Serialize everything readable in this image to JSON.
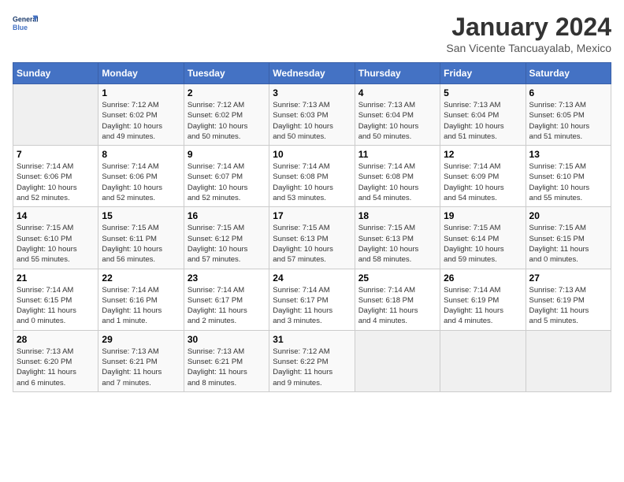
{
  "header": {
    "logo_line1": "General",
    "logo_line2": "Blue",
    "month_year": "January 2024",
    "location": "San Vicente Tancuayalab, Mexico"
  },
  "days_of_week": [
    "Sunday",
    "Monday",
    "Tuesday",
    "Wednesday",
    "Thursday",
    "Friday",
    "Saturday"
  ],
  "weeks": [
    [
      {
        "day": "",
        "info": ""
      },
      {
        "day": "1",
        "info": "Sunrise: 7:12 AM\nSunset: 6:02 PM\nDaylight: 10 hours\nand 49 minutes."
      },
      {
        "day": "2",
        "info": "Sunrise: 7:12 AM\nSunset: 6:02 PM\nDaylight: 10 hours\nand 50 minutes."
      },
      {
        "day": "3",
        "info": "Sunrise: 7:13 AM\nSunset: 6:03 PM\nDaylight: 10 hours\nand 50 minutes."
      },
      {
        "day": "4",
        "info": "Sunrise: 7:13 AM\nSunset: 6:04 PM\nDaylight: 10 hours\nand 50 minutes."
      },
      {
        "day": "5",
        "info": "Sunrise: 7:13 AM\nSunset: 6:04 PM\nDaylight: 10 hours\nand 51 minutes."
      },
      {
        "day": "6",
        "info": "Sunrise: 7:13 AM\nSunset: 6:05 PM\nDaylight: 10 hours\nand 51 minutes."
      }
    ],
    [
      {
        "day": "7",
        "info": "Sunrise: 7:14 AM\nSunset: 6:06 PM\nDaylight: 10 hours\nand 52 minutes."
      },
      {
        "day": "8",
        "info": "Sunrise: 7:14 AM\nSunset: 6:06 PM\nDaylight: 10 hours\nand 52 minutes."
      },
      {
        "day": "9",
        "info": "Sunrise: 7:14 AM\nSunset: 6:07 PM\nDaylight: 10 hours\nand 52 minutes."
      },
      {
        "day": "10",
        "info": "Sunrise: 7:14 AM\nSunset: 6:08 PM\nDaylight: 10 hours\nand 53 minutes."
      },
      {
        "day": "11",
        "info": "Sunrise: 7:14 AM\nSunset: 6:08 PM\nDaylight: 10 hours\nand 54 minutes."
      },
      {
        "day": "12",
        "info": "Sunrise: 7:14 AM\nSunset: 6:09 PM\nDaylight: 10 hours\nand 54 minutes."
      },
      {
        "day": "13",
        "info": "Sunrise: 7:15 AM\nSunset: 6:10 PM\nDaylight: 10 hours\nand 55 minutes."
      }
    ],
    [
      {
        "day": "14",
        "info": "Sunrise: 7:15 AM\nSunset: 6:10 PM\nDaylight: 10 hours\nand 55 minutes."
      },
      {
        "day": "15",
        "info": "Sunrise: 7:15 AM\nSunset: 6:11 PM\nDaylight: 10 hours\nand 56 minutes."
      },
      {
        "day": "16",
        "info": "Sunrise: 7:15 AM\nSunset: 6:12 PM\nDaylight: 10 hours\nand 57 minutes."
      },
      {
        "day": "17",
        "info": "Sunrise: 7:15 AM\nSunset: 6:13 PM\nDaylight: 10 hours\nand 57 minutes."
      },
      {
        "day": "18",
        "info": "Sunrise: 7:15 AM\nSunset: 6:13 PM\nDaylight: 10 hours\nand 58 minutes."
      },
      {
        "day": "19",
        "info": "Sunrise: 7:15 AM\nSunset: 6:14 PM\nDaylight: 10 hours\nand 59 minutes."
      },
      {
        "day": "20",
        "info": "Sunrise: 7:15 AM\nSunset: 6:15 PM\nDaylight: 11 hours\nand 0 minutes."
      }
    ],
    [
      {
        "day": "21",
        "info": "Sunrise: 7:14 AM\nSunset: 6:15 PM\nDaylight: 11 hours\nand 0 minutes."
      },
      {
        "day": "22",
        "info": "Sunrise: 7:14 AM\nSunset: 6:16 PM\nDaylight: 11 hours\nand 1 minute."
      },
      {
        "day": "23",
        "info": "Sunrise: 7:14 AM\nSunset: 6:17 PM\nDaylight: 11 hours\nand 2 minutes."
      },
      {
        "day": "24",
        "info": "Sunrise: 7:14 AM\nSunset: 6:17 PM\nDaylight: 11 hours\nand 3 minutes."
      },
      {
        "day": "25",
        "info": "Sunrise: 7:14 AM\nSunset: 6:18 PM\nDaylight: 11 hours\nand 4 minutes."
      },
      {
        "day": "26",
        "info": "Sunrise: 7:14 AM\nSunset: 6:19 PM\nDaylight: 11 hours\nand 4 minutes."
      },
      {
        "day": "27",
        "info": "Sunrise: 7:13 AM\nSunset: 6:19 PM\nDaylight: 11 hours\nand 5 minutes."
      }
    ],
    [
      {
        "day": "28",
        "info": "Sunrise: 7:13 AM\nSunset: 6:20 PM\nDaylight: 11 hours\nand 6 minutes."
      },
      {
        "day": "29",
        "info": "Sunrise: 7:13 AM\nSunset: 6:21 PM\nDaylight: 11 hours\nand 7 minutes."
      },
      {
        "day": "30",
        "info": "Sunrise: 7:13 AM\nSunset: 6:21 PM\nDaylight: 11 hours\nand 8 minutes."
      },
      {
        "day": "31",
        "info": "Sunrise: 7:12 AM\nSunset: 6:22 PM\nDaylight: 11 hours\nand 9 minutes."
      },
      {
        "day": "",
        "info": ""
      },
      {
        "day": "",
        "info": ""
      },
      {
        "day": "",
        "info": ""
      }
    ]
  ]
}
